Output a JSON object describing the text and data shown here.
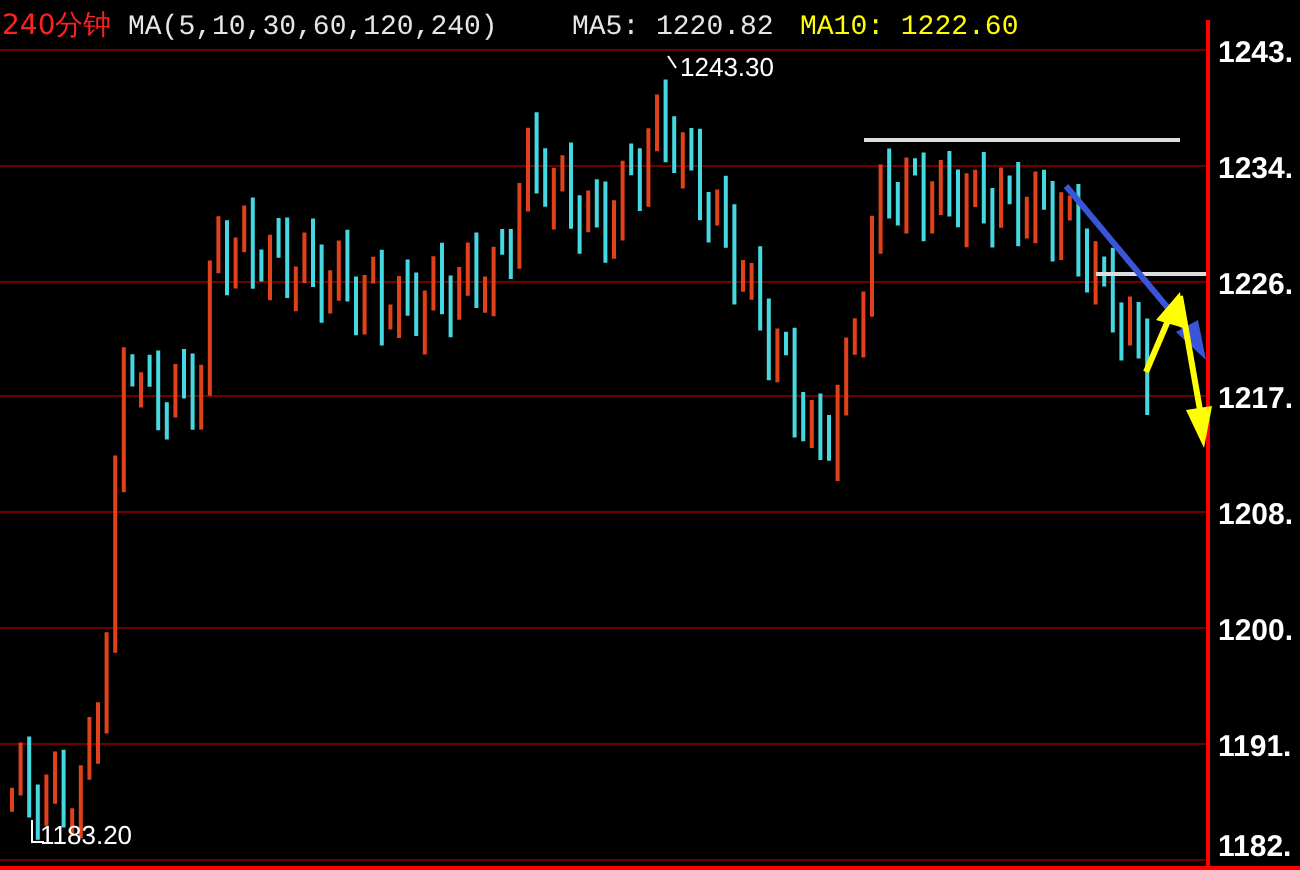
{
  "header": {
    "period": "240分钟",
    "indicator": "MA(5,10,30,60,120,240)",
    "ma_readings": [
      {
        "label": "MA5:",
        "value": "1220.82",
        "color": "#e6e6e6"
      },
      {
        "label": "MA10:",
        "value": "1222.60",
        "color": "#ffff00"
      }
    ]
  },
  "price_axis": {
    "labels": [
      "1243.",
      "1234.",
      "1226.",
      "1217.",
      "1208.",
      "1200.",
      "1191.",
      "1182."
    ]
  },
  "markers": [
    {
      "kind": "high",
      "text": "1243.30"
    },
    {
      "kind": "low",
      "text": "1183.20"
    }
  ]
}
